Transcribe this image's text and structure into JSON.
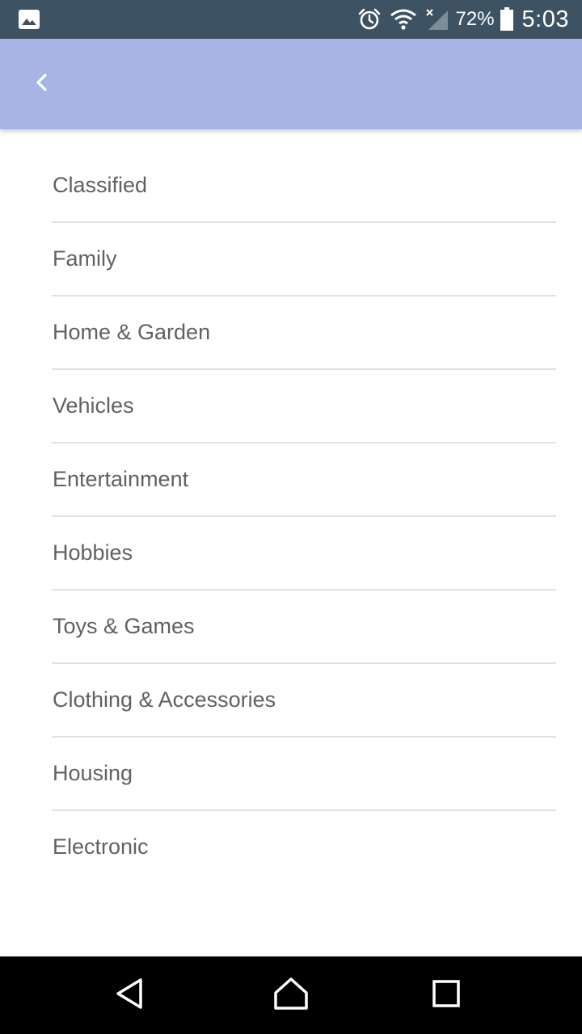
{
  "status_bar": {
    "battery_percent": "72%",
    "time": "5:03",
    "icons": [
      "image-notification-icon",
      "alarm-icon",
      "wifi-icon",
      "cell-signal-off-icon",
      "battery-icon"
    ]
  },
  "app_bar": {
    "background_color": "#a9b4e6",
    "back_icon": "chevron-left-icon"
  },
  "categories": [
    {
      "label": "Classified"
    },
    {
      "label": "Family"
    },
    {
      "label": "Home & Garden"
    },
    {
      "label": "Vehicles"
    },
    {
      "label": "Entertainment"
    },
    {
      "label": "Hobbies"
    },
    {
      "label": "Toys & Games"
    },
    {
      "label": "Clothing & Accessories"
    },
    {
      "label": "Housing"
    },
    {
      "label": "Electronic"
    }
  ],
  "nav_bar": {
    "buttons": [
      "back-triangle-icon",
      "home-icon",
      "recents-square-icon"
    ]
  }
}
